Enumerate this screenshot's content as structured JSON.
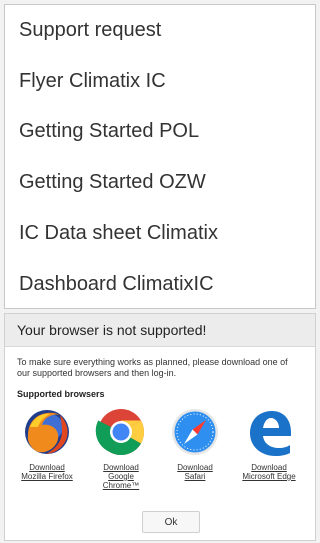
{
  "menu": {
    "items": [
      {
        "label": "Support request"
      },
      {
        "label": "Flyer Climatix IC"
      },
      {
        "label": "Getting Started POL"
      },
      {
        "label": "Getting Started OZW"
      },
      {
        "label": "IC Data sheet Climatix"
      },
      {
        "label": "Dashboard ClimatixIC"
      }
    ]
  },
  "dialog": {
    "title": "Your browser is not supported!",
    "message": "To make sure everything works as planned, please download one of our supported browsers and then log-in.",
    "supported_title": "Supported browsers",
    "browsers": [
      {
        "label": "Download\nMozilla Firefox",
        "icon": "firefox-icon"
      },
      {
        "label": "Download\nGoogle\nChrome™",
        "icon": "chrome-icon"
      },
      {
        "label": "Download\nSafari",
        "icon": "safari-icon"
      },
      {
        "label": "Download\nMicrosoft Edge",
        "icon": "edge-icon"
      }
    ],
    "ok_label": "Ok"
  }
}
